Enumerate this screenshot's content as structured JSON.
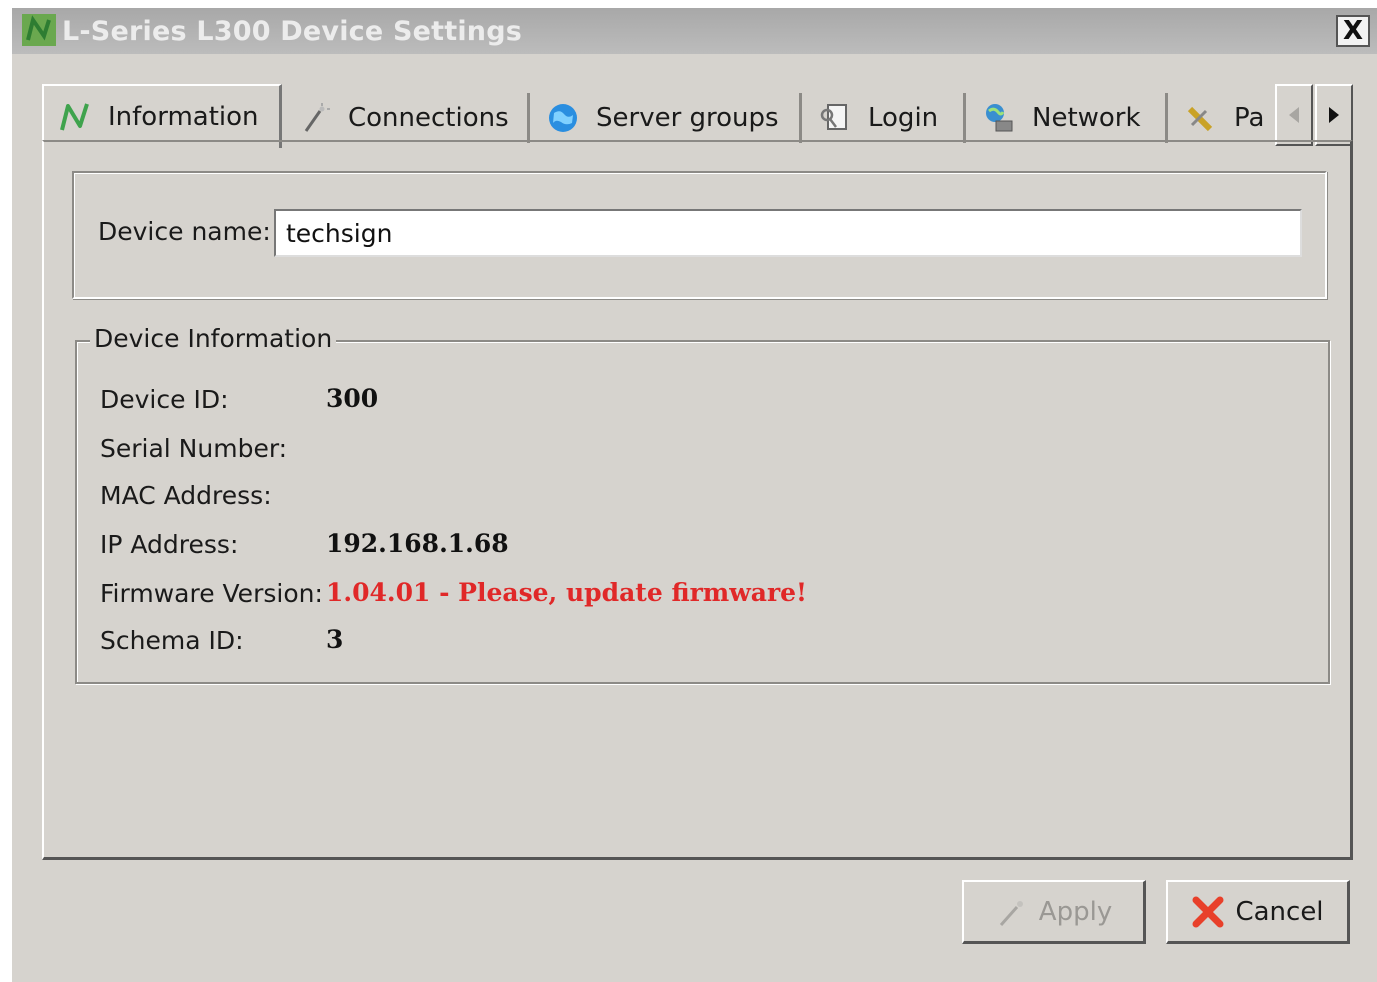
{
  "window": {
    "title": "L-Series L300 Device Settings",
    "close_label": "X"
  },
  "tabs": [
    {
      "label": "Information",
      "icon": "nexmosphere-logo-icon",
      "active": true
    },
    {
      "label": "Connections",
      "icon": "magic-wand-icon",
      "active": false
    },
    {
      "label": "Server groups",
      "icon": "globe-icon",
      "active": false
    },
    {
      "label": "Login",
      "icon": "key-document-icon",
      "active": false
    },
    {
      "label": "Network",
      "icon": "network-computer-icon",
      "active": false
    },
    {
      "label": "Pa",
      "icon": "pencil-tools-icon",
      "active": false
    }
  ],
  "device_name": {
    "label": "Device name:",
    "value": "techsign"
  },
  "device_info": {
    "title": "Device Information",
    "rows": [
      {
        "label": "Device ID:",
        "value": "300"
      },
      {
        "label": "Serial Number:",
        "value": ""
      },
      {
        "label": "MAC Address:",
        "value": ""
      },
      {
        "label": "IP Address:",
        "value": "192.168.1.68"
      },
      {
        "label": "Firmware Version:",
        "value": "1.04.01 - Please, update firmware!"
      },
      {
        "label": "Schema ID:",
        "value": "3"
      }
    ]
  },
  "buttons": {
    "apply": "Apply",
    "cancel": "Cancel"
  },
  "colors": {
    "window_bg": "#d6d3ce",
    "warning_red": "#e02828",
    "titlebar": "#b0b0b0"
  }
}
